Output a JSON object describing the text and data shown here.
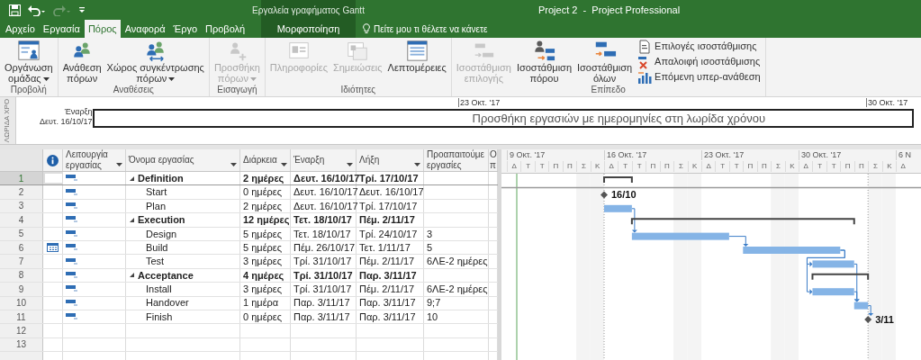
{
  "title_bar": {
    "title": "Project 2  -  Project Professional",
    "context_label": "Εργαλεία γραφήματος Gantt",
    "quick_access": [
      {
        "kind": "save",
        "disabled": false
      },
      {
        "kind": "undo",
        "disabled": false
      },
      {
        "kind": "redo",
        "disabled": true
      },
      {
        "kind": "customize",
        "disabled": false
      }
    ]
  },
  "tabs": [
    {
      "label": "Αρχείο",
      "selected": false,
      "contextual": false
    },
    {
      "label": "Εργασία",
      "selected": false,
      "contextual": false
    },
    {
      "label": "Πόρος",
      "selected": true,
      "contextual": false
    },
    {
      "label": "Αναφορά",
      "selected": false,
      "contextual": false
    },
    {
      "label": "Έργο",
      "selected": false,
      "contextual": false
    },
    {
      "label": "Προβολή",
      "selected": false,
      "contextual": false
    },
    {
      "label": "Μορφοποίηση",
      "selected": false,
      "contextual": true
    }
  ],
  "tell_me": {
    "text": "Πείτε μου τι θέλετε να κάνετε"
  },
  "ribbon": {
    "groups": [
      {
        "label": "Προβολή",
        "buttons": [
          {
            "kind": "large",
            "lines": [
              "Οργάνωση",
              "ομάδας"
            ],
            "dropdown": true,
            "disabled": false
          }
        ]
      },
      {
        "label": "Αναθέσεις",
        "buttons": [
          {
            "kind": "large",
            "lines": [
              "Ανάθεση",
              "πόρων"
            ],
            "dropdown": false,
            "disabled": false
          },
          {
            "kind": "large",
            "lines": [
              "Χώρος συγκέντρωσης",
              "πόρων"
            ],
            "dropdown": true,
            "disabled": false
          }
        ]
      },
      {
        "label": "Εισαγωγή",
        "buttons": [
          {
            "kind": "large",
            "lines": [
              "Προσθήκη",
              "πόρων"
            ],
            "dropdown": true,
            "disabled": true
          }
        ]
      },
      {
        "label": "Ιδιότητες",
        "buttons": [
          {
            "kind": "large",
            "lines": [
              "Πληροφορίες"
            ],
            "dropdown": false,
            "disabled": true
          },
          {
            "kind": "large",
            "lines": [
              "Σημειώσεις"
            ],
            "dropdown": false,
            "disabled": true
          },
          {
            "kind": "large",
            "lines": [
              "Λεπτομέρειες"
            ],
            "dropdown": false,
            "disabled": false
          }
        ]
      },
      {
        "label": "Επίπεδο",
        "buttons": [
          {
            "kind": "large",
            "lines": [
              "Ισοστάθμιση",
              "επιλογής"
            ],
            "dropdown": false,
            "disabled": true
          },
          {
            "kind": "large",
            "lines": [
              "Ισοστάθμιση",
              "πόρου"
            ],
            "dropdown": false,
            "disabled": false
          },
          {
            "kind": "large",
            "lines": [
              "Ισοστάθμιση",
              "όλων"
            ],
            "dropdown": false,
            "disabled": false
          },
          {
            "kind": "small",
            "lines": [
              "Επιλογές ισοστάθμισης"
            ],
            "dropdown": false,
            "disabled": false
          },
          {
            "kind": "small",
            "lines": [
              "Απαλοιφή ισοστάθμισης"
            ],
            "dropdown": false,
            "disabled": false
          },
          {
            "kind": "small",
            "lines": [
              "Επόμενη υπερ-ανάθεση"
            ],
            "dropdown": false,
            "disabled": false
          }
        ]
      }
    ]
  },
  "timeline": {
    "side_label": "ΛΩΡΙΔΑ ΧΡΟ",
    "start_label": "Έναρξη",
    "start_date": "Δευτ. 16/10/17",
    "placeholder": "Προσθήκη εργασιών με ημερομηνίες στη λωρίδα χρόνου",
    "ticks": [
      "23 Οκτ. '17",
      "30 Οκτ. '17"
    ]
  },
  "table": {
    "columns": [
      {
        "kind": "indicator",
        "filter": false
      },
      {
        "kind": "text",
        "label": "Λειτουργία εργασίας",
        "filter": true
      },
      {
        "kind": "text",
        "label": "Όνομα εργασίας",
        "filter": true
      },
      {
        "kind": "text",
        "label": "Διάρκεια",
        "filter": true
      },
      {
        "kind": "text",
        "label": "Έναρξη",
        "filter": true
      },
      {
        "kind": "text",
        "label": "Λήξη",
        "filter": true
      },
      {
        "kind": "text",
        "label": "Προαπαιτούμε εργασίες",
        "filter": false
      },
      {
        "kind": "text",
        "label": "Ο π",
        "filter": false
      }
    ],
    "tasks": [
      {
        "id": "1",
        "kind": "summary",
        "name": "Definition",
        "duration": "2 ημέρες",
        "start": "Δευτ. 16/10/17",
        "finish": "Τρί. 17/10/17",
        "selected": true,
        "expanded": true,
        "calendar_indicator": false,
        "children": [
          {
            "id": "2",
            "kind": "milestone",
            "name": "Start",
            "duration": "0 ημέρες",
            "start": "Δευτ. 16/10/17",
            "finish": "Δευτ. 16/10/17",
            "selected": false,
            "calendar_indicator": false,
            "bar_label": "16/10"
          },
          {
            "id": "3",
            "kind": "task",
            "name": "Plan",
            "duration": "2 ημέρες",
            "start": "Δευτ. 16/10/17",
            "finish": "Τρί. 17/10/17",
            "selected": false,
            "calendar_indicator": false
          }
        ]
      },
      {
        "id": "4",
        "kind": "summary",
        "name": "Execution",
        "duration": "12 ημέρες",
        "start": "Τετ. 18/10/17",
        "finish": "Πέμ. 2/11/17",
        "selected": false,
        "expanded": true,
        "calendar_indicator": false,
        "children": [
          {
            "id": "5",
            "kind": "task",
            "name": "Design",
            "duration": "5 ημέρες",
            "start": "Τετ. 18/10/17",
            "finish": "Τρί. 24/10/17",
            "predecessors": "3",
            "selected": false,
            "calendar_indicator": false
          },
          {
            "id": "6",
            "kind": "task",
            "name": "Build",
            "duration": "5 ημέρες",
            "start": "Πέμ. 26/10/17",
            "finish": "Τετ. 1/11/17",
            "predecessors": "5",
            "selected": false,
            "calendar_indicator": true
          },
          {
            "id": "7",
            "kind": "task",
            "name": "Test",
            "duration": "3 ημέρες",
            "start": "Τρί. 31/10/17",
            "finish": "Πέμ. 2/11/17",
            "predecessors": "6ΛΕ-2 ημέρες",
            "selected": false,
            "calendar_indicator": false
          }
        ]
      },
      {
        "id": "8",
        "kind": "summary",
        "name": "Acceptance",
        "duration": "4 ημέρες",
        "start": "Τρί. 31/10/17",
        "finish": "Παρ. 3/11/17",
        "selected": false,
        "expanded": true,
        "calendar_indicator": false,
        "children": [
          {
            "id": "9",
            "kind": "task",
            "name": "Install",
            "duration": "3 ημέρες",
            "start": "Τρί. 31/10/17",
            "finish": "Πέμ. 2/11/17",
            "predecessors": "6ΛΕ-2 ημέρες",
            "selected": false,
            "calendar_indicator": false
          },
          {
            "id": "10",
            "kind": "task",
            "name": "Handover",
            "duration": "1 ημέρα",
            "start": "Παρ. 3/11/17",
            "finish": "Παρ. 3/11/17",
            "predecessors": "9;7",
            "selected": false,
            "calendar_indicator": false
          },
          {
            "id": "11",
            "kind": "milestone",
            "name": "Finish",
            "duration": "0 ημέρες",
            "start": "Παρ. 3/11/17",
            "finish": "Παρ. 3/11/17",
            "predecessors": "10",
            "selected": false,
            "calendar_indicator": false,
            "bar_label": "3/11"
          }
        ]
      }
    ],
    "empty_rows": [
      "12",
      "13"
    ]
  },
  "gantt": {
    "weeks": [
      {
        "label": "9 Οκτ. '17",
        "days": [
          "Δ",
          "Τ",
          "Τ",
          "Π",
          "Π",
          "Σ",
          "Κ"
        ]
      },
      {
        "label": "16 Οκτ. '17",
        "days": [
          "Δ",
          "Τ",
          "Τ",
          "Π",
          "Π",
          "Σ",
          "Κ"
        ]
      },
      {
        "label": "23 Οκτ. '17",
        "days": [
          "Δ",
          "Τ",
          "Τ",
          "Π",
          "Π",
          "Σ",
          "Κ"
        ]
      },
      {
        "label": "30 Οκτ. '17",
        "days": [
          "Δ",
          "Τ",
          "Τ",
          "Π",
          "Π",
          "Σ",
          "Κ"
        ]
      },
      {
        "label": "6 Ν",
        "days": [
          "Δ"
        ]
      }
    ]
  }
}
